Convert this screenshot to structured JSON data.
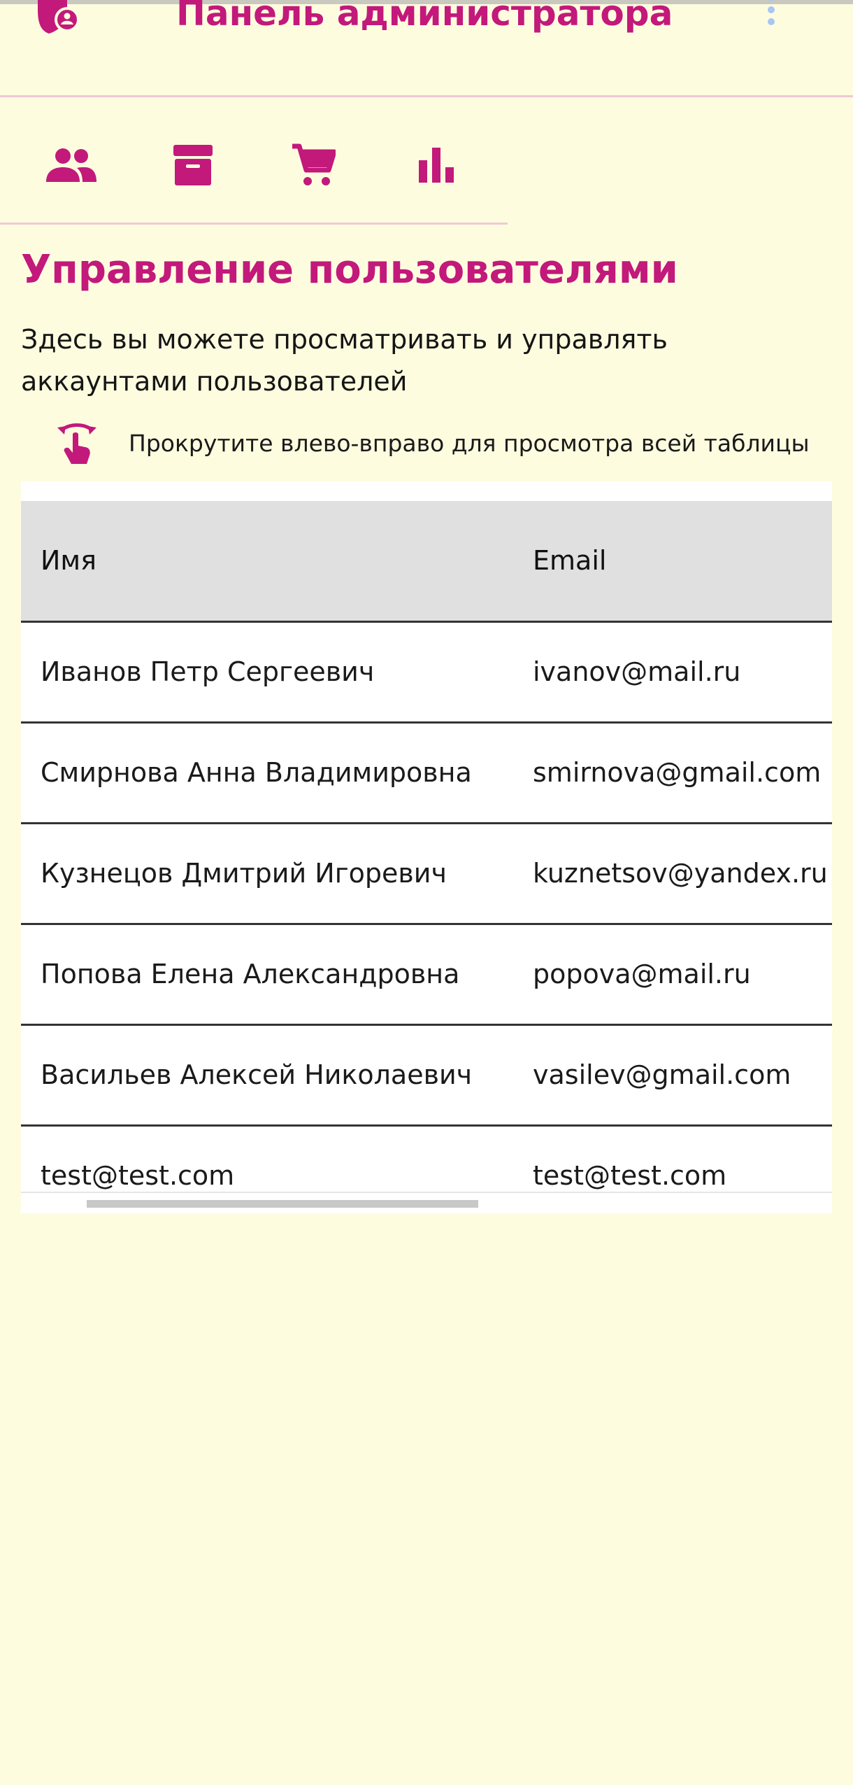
{
  "app": {
    "title": "Панель администратора",
    "accent_color": "#c2197b",
    "logo_icon": "admin-shield-icon",
    "menu_icon": "more-vert-icon"
  },
  "tabs": [
    {
      "icon": "people-icon",
      "active": true
    },
    {
      "icon": "archive-icon",
      "active": false
    },
    {
      "icon": "shopping-cart-icon",
      "active": false
    },
    {
      "icon": "bar-chart-icon",
      "active": false
    }
  ],
  "section": {
    "title": "Управление пользователями",
    "description": "Здесь вы можете просматривать и управлять аккаунтами пользователей"
  },
  "hint": {
    "icon": "swipe-horizontal-icon",
    "text": "Прокрутите влево-вправо для просмотра всей таблицы"
  },
  "table": {
    "columns": [
      "Имя",
      "Email"
    ],
    "rows": [
      [
        "Иванов Петр Сергеевич",
        "ivanov@mail.ru"
      ],
      [
        "Смирнова Анна Владимировна",
        "smirnova@gmail.com"
      ],
      [
        "Кузнецов Дмитрий Игоревич",
        "kuznetsov@yandex.ru"
      ],
      [
        "Попова Елена Александровна",
        "popova@mail.ru"
      ],
      [
        "Васильев Алексей Николаевич",
        "vasilev@gmail.com"
      ],
      [
        "test@test.com",
        "test@test.com"
      ]
    ]
  }
}
